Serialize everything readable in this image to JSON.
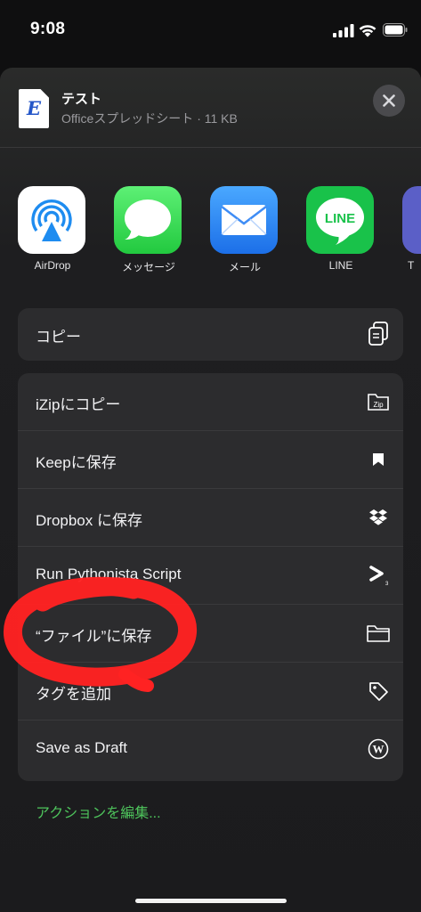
{
  "status_bar": {
    "time": "9:08"
  },
  "header": {
    "file_name": "テスト",
    "file_meta": "Officeスプレッドシート · 11 KB",
    "doc_icon_letter": "E"
  },
  "apps": [
    {
      "label": "AirDrop",
      "icon": "airdrop-icon"
    },
    {
      "label": "メッセージ",
      "icon": "messages-icon"
    },
    {
      "label": "メール",
      "icon": "mail-icon"
    },
    {
      "label": "LINE",
      "icon": "line-icon",
      "icon_text": "LINE"
    },
    {
      "label": "T",
      "icon": "partial-app-icon"
    }
  ],
  "copy_card": {
    "label": "コピー",
    "icon": "copy-icon"
  },
  "actions": [
    {
      "label": "iZipにコピー",
      "icon": "zip-folder-icon",
      "icon_text": "Zip"
    },
    {
      "label": "Keepに保存",
      "icon": "bookmark-icon"
    },
    {
      "label": "Dropbox に保存",
      "icon": "dropbox-icon"
    },
    {
      "label": "Run Pythonista Script",
      "icon": "pythonista-icon"
    },
    {
      "label": "“ファイル”に保存",
      "icon": "folder-icon"
    },
    {
      "label": "タグを追加",
      "icon": "tag-icon"
    },
    {
      "label": "Save as Draft",
      "icon": "wordpress-icon",
      "icon_text": "W"
    }
  ],
  "edit_actions_label": "アクションを編集...",
  "colors": {
    "accent_green": "#4ec45c",
    "annotation_red": "#ff2222",
    "sheet_bg": "#1b1b1d",
    "card_bg": "#2c2c2e"
  }
}
